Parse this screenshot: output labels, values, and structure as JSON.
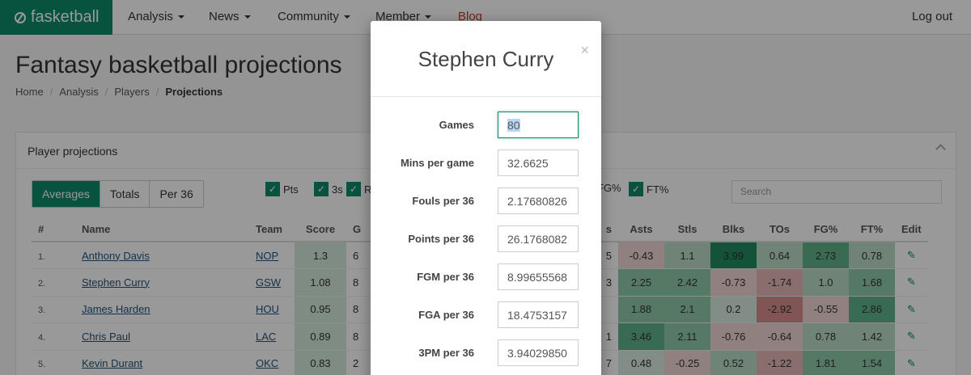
{
  "nav": {
    "brand": "fasketball",
    "items": [
      "Analysis",
      "News",
      "Community",
      "Member",
      "Blog"
    ],
    "logout": "Log out"
  },
  "page": {
    "title": "Fantasy basketball projections",
    "breadcrumb": [
      "Home",
      "Analysis",
      "Players",
      "Projections"
    ]
  },
  "panel": {
    "title": "Player projections",
    "views": [
      "Averages",
      "Totals",
      "Per 36"
    ],
    "checkboxes": [
      "Pts",
      "3s",
      "R",
      "FG%",
      "FT%"
    ],
    "search_placeholder": "Search"
  },
  "table": {
    "headers": [
      "#",
      "Name",
      "Team",
      "Score",
      "G",
      "s",
      "Asts",
      "Stls",
      "Blks",
      "TOs",
      "FG%",
      "FT%",
      "Edit"
    ],
    "rows": [
      {
        "rank": "1.",
        "name": "Anthony Davis",
        "team": "NOP",
        "score": "1.3",
        "g": "6",
        "s": "5",
        "asts": "-0.43",
        "stls": "1.1",
        "blks": "3.99",
        "tos": "0.64",
        "fg": "2.73",
        "ft": "0.78"
      },
      {
        "rank": "2.",
        "name": "Stephen Curry",
        "team": "GSW",
        "score": "1.08",
        "g": "8",
        "s": "3",
        "asts": "2.25",
        "stls": "2.42",
        "blks": "-0.73",
        "tos": "-1.74",
        "fg": "1.0",
        "ft": "1.68"
      },
      {
        "rank": "3.",
        "name": "James Harden",
        "team": "HOU",
        "score": "0.95",
        "g": "8",
        "s": "",
        "asts": "1.88",
        "stls": "2.1",
        "blks": "0.2",
        "tos": "-2.92",
        "fg": "-0.55",
        "ft": "2.86"
      },
      {
        "rank": "4.",
        "name": "Chris Paul",
        "team": "LAC",
        "score": "0.89",
        "g": "8",
        "s": "1",
        "asts": "3.46",
        "stls": "2.11",
        "blks": "-0.76",
        "tos": "-0.64",
        "fg": "0.78",
        "ft": "1.42"
      },
      {
        "rank": "5.",
        "name": "Kevin Durant",
        "team": "OKC",
        "score": "0.83",
        "g": "2",
        "s": "7",
        "asts": "0.48",
        "stls": "-0.25",
        "blks": "0.52",
        "tos": "-1.22",
        "fg": "1.81",
        "ft": "1.54"
      }
    ]
  },
  "modal": {
    "title": "Stephen Curry",
    "close": "×",
    "fields": [
      {
        "label": "Games",
        "value": "80"
      },
      {
        "label": "Mins per game",
        "value": "32.6625"
      },
      {
        "label": "Fouls per 36",
        "value": "2.17680826"
      },
      {
        "label": "Points per 36",
        "value": "26.1768082"
      },
      {
        "label": "FGM per 36",
        "value": "8.99655568"
      },
      {
        "label": "FGA per 36",
        "value": "18.4753157"
      },
      {
        "label": "3PM per 36",
        "value": "3.94029850"
      }
    ]
  },
  "colors": {
    "brand": "#0e8a6b",
    "blog": "#c0392b"
  }
}
